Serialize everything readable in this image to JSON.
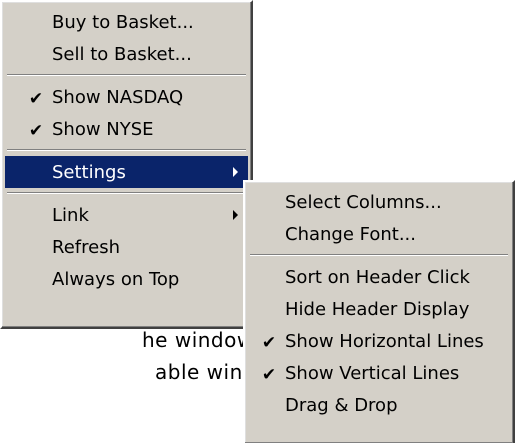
{
  "background": {
    "line1": "he window you",
    "line2": "able windows."
  },
  "main_menu": {
    "items": [
      {
        "label": "Buy to Basket..."
      },
      {
        "label": "Sell to Basket..."
      },
      {
        "label": "Show NASDAQ",
        "checked": true
      },
      {
        "label": "Show NYSE",
        "checked": true
      },
      {
        "label": "Settings",
        "submenu": true,
        "selected": true
      },
      {
        "label": "Link",
        "submenu": true
      },
      {
        "label": "Refresh"
      },
      {
        "label": "Always on Top"
      }
    ],
    "check_glyph": "✔"
  },
  "settings_submenu": {
    "items": [
      {
        "label": "Select Columns..."
      },
      {
        "label": "Change Font..."
      },
      {
        "label": "Sort on Header Click"
      },
      {
        "label": "Hide Header Display"
      },
      {
        "label": "Show Horizontal Lines",
        "checked": true
      },
      {
        "label": "Show Vertical Lines",
        "checked": true
      },
      {
        "label": "Drag & Drop"
      }
    ],
    "check_glyph": "✔"
  },
  "colors": {
    "menu_bg": "#d4d0c8",
    "highlight": "#0a246a",
    "highlight_text": "#ffffff"
  }
}
